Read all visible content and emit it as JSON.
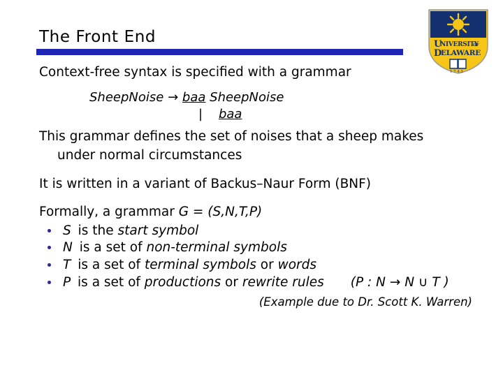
{
  "slide": {
    "title": "The Front End",
    "accent_color": "#1f26b5",
    "bullet_color": "#2b2b96",
    "background_color": "#ffffff",
    "text_color": "#000000"
  },
  "logo": {
    "name": "University of Delaware shield",
    "line1": "UNIVERSITY",
    "of": "OF",
    "line2": "DELAWARE",
    "year": "1743",
    "shield_blue": "#14306e",
    "shield_yellow": "#f5c518"
  },
  "body": {
    "intro": "Context-free syntax is specified with a grammar",
    "rule": {
      "lhs": "SheepNoise",
      "arrow": "→",
      "rhs_terminal": "baa",
      "rhs_nonterminal": "SheepNoise",
      "alt_bar": "|",
      "alt_terminal": "baa"
    },
    "defines_line1": "This grammar defines the set of noises that a sheep makes",
    "defines_line2": "under normal circumstances",
    "bnf_line": "It is written in a variant of Backus–Naur Form (BNF)",
    "formal_intro_prefix": "Formally, a grammar ",
    "formal_intro_expr": "G = (S,N,T,P)",
    "bullets": [
      {
        "symbol": "S",
        "text_plain": " is the ",
        "text_em": "start symbol",
        "tail": ""
      },
      {
        "symbol": "N",
        "text_plain": " is a set of ",
        "text_em": "non-terminal symbols",
        "tail": ""
      },
      {
        "symbol": "T",
        "text_plain": " is a set of ",
        "text_em": "terminal symbols",
        "mid": " or ",
        "text_em2": "words",
        "tail": ""
      },
      {
        "symbol": "P",
        "text_plain": " is a set of ",
        "text_em": "productions",
        "mid": " or ",
        "text_em2": "rewrite rules",
        "notation": "(P : N → N ∪ T )"
      }
    ],
    "credit": "(Example due to Dr. Scott K. Warren)"
  }
}
